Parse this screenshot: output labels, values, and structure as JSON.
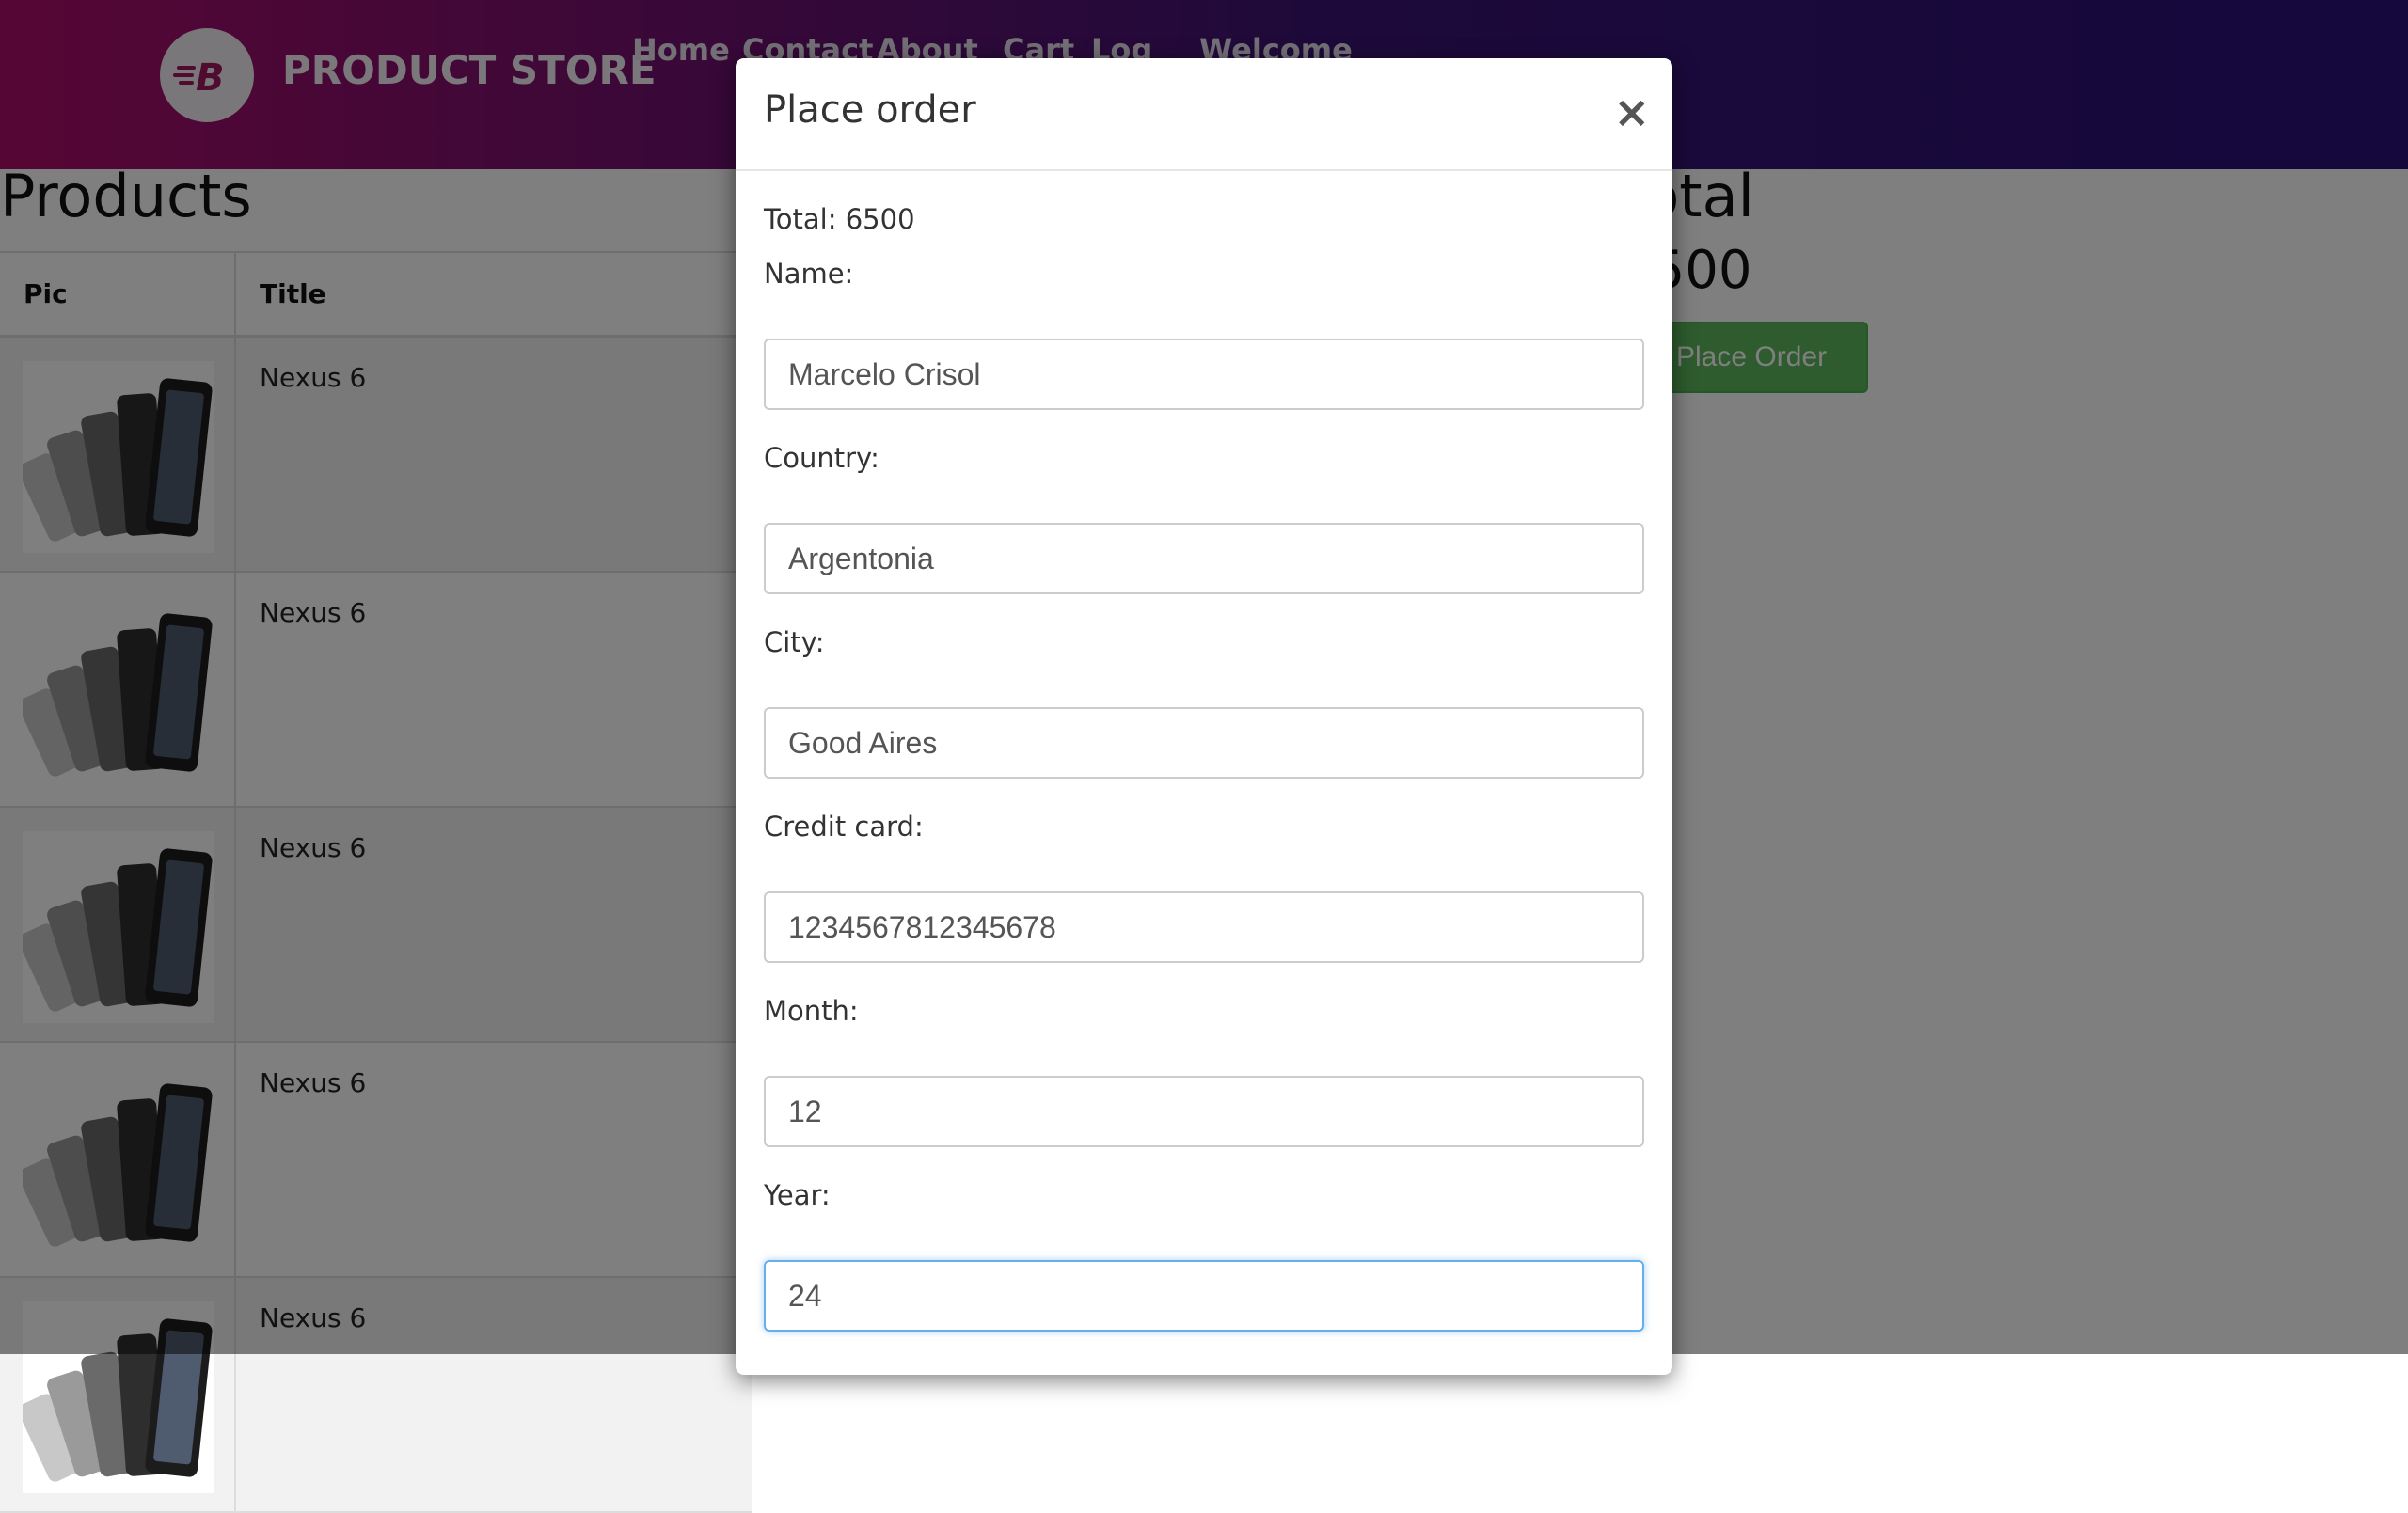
{
  "navbar": {
    "brand": "PRODUCT STORE",
    "links": [
      "Home",
      "Contact",
      "About",
      "Cart",
      "Log",
      "Welcome"
    ]
  },
  "products": {
    "heading": "Products",
    "columns": [
      "Pic",
      "Title"
    ],
    "rows": [
      {
        "title": "Nexus 6"
      },
      {
        "title": "Nexus 6"
      },
      {
        "title": "Nexus 6"
      },
      {
        "title": "Nexus 6"
      },
      {
        "title": "Nexus 6"
      }
    ]
  },
  "total": {
    "heading": "Total",
    "value": "6500",
    "place_order_label": "Place Order"
  },
  "modal": {
    "title": "Place order",
    "close_symbol": "×",
    "total_text": "Total: 6500",
    "fields": [
      {
        "label": "Name:",
        "value": "Marcelo Crisol"
      },
      {
        "label": "Country:",
        "value": "Argentonia"
      },
      {
        "label": "City:",
        "value": "Good Aires"
      },
      {
        "label": "Credit card:",
        "value": "1234567812345678"
      },
      {
        "label": "Month:",
        "value": "12"
      },
      {
        "label": "Year:",
        "value": "24"
      }
    ]
  },
  "colors": {
    "nav_start": "#ad0d6a",
    "nav_end": "#2a1078",
    "success": "#5cb85c",
    "focus": "#66afe9"
  }
}
